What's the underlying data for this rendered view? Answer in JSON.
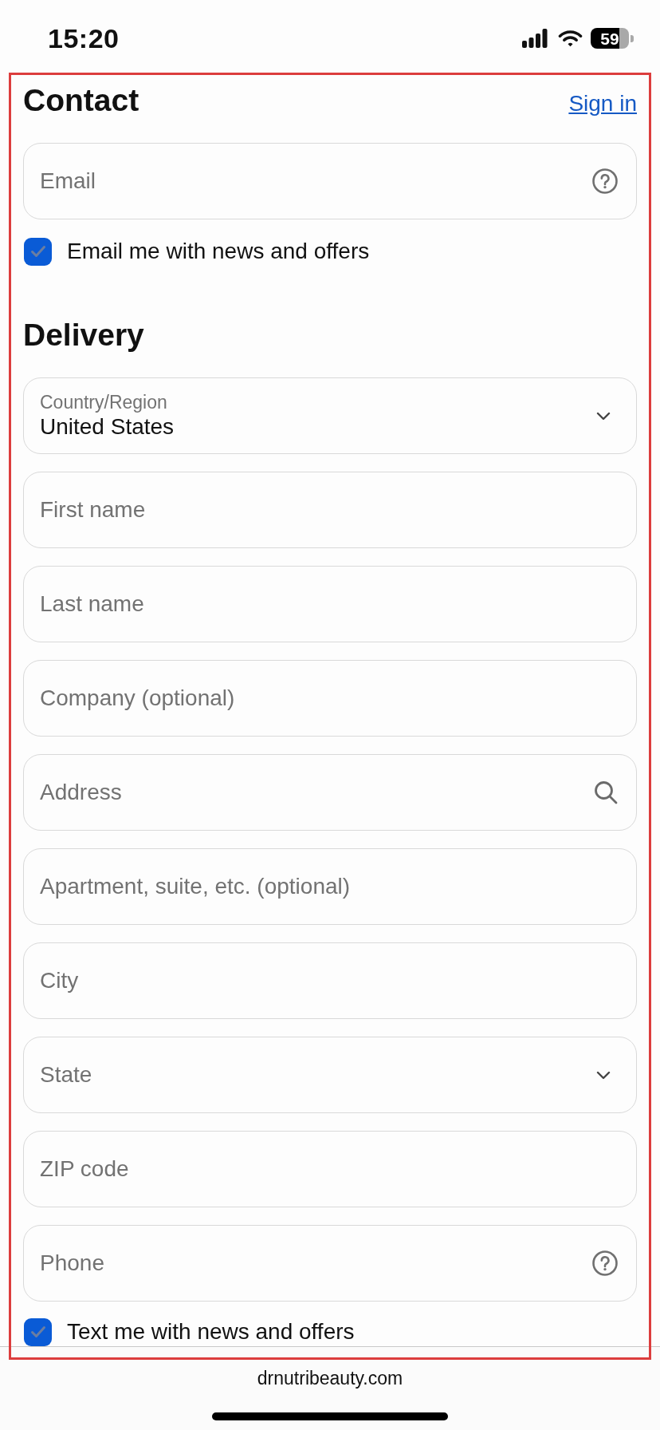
{
  "status_bar": {
    "time": "15:20",
    "battery": "59"
  },
  "contact": {
    "title": "Contact",
    "sign_in": "Sign in",
    "email": {
      "kind": "help",
      "placeholder": "Email"
    },
    "newsletter": {
      "label": "Email me with news and offers",
      "checked": true
    }
  },
  "delivery": {
    "title": "Delivery",
    "fields": [
      {
        "kind": "select",
        "label": "Country/Region",
        "value": "United States"
      },
      {
        "kind": "plain",
        "placeholder": "First name"
      },
      {
        "kind": "plain",
        "placeholder": "Last name"
      },
      {
        "kind": "plain",
        "placeholder": "Company (optional)"
      },
      {
        "kind": "search",
        "placeholder": "Address"
      },
      {
        "kind": "plain",
        "placeholder": "Apartment, suite, etc. (optional)"
      },
      {
        "kind": "plain",
        "placeholder": "City"
      },
      {
        "kind": "select",
        "placeholder": "State"
      },
      {
        "kind": "plain",
        "placeholder": "ZIP code"
      },
      {
        "kind": "help",
        "placeholder": "Phone"
      }
    ],
    "sms": {
      "label": "Text me with news and offers",
      "checked": true
    }
  },
  "browser_bar": {
    "url": "drnutribeauty.com"
  }
}
